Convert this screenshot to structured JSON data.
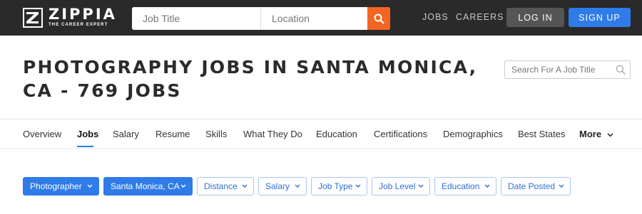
{
  "header": {
    "logo_word": "ZIPPIA",
    "logo_tagline": "THE CAREER EXPERT",
    "job_title_placeholder": "Job Title",
    "location_placeholder": "Location",
    "nav_jobs": "JOBS",
    "nav_careers": "CAREERS",
    "login_label": "LOG IN",
    "signup_label": "SIGN UP",
    "accent": "#f26522",
    "brand_blue": "#2f7be8"
  },
  "page": {
    "title": "PHOTOGRAPHY JOBS IN SANTA MONICA, CA - 769 JOBS",
    "job_search_placeholder": "Search For A Job Title"
  },
  "tabs": {
    "items": [
      "Overview",
      "Jobs",
      "Salary",
      "Resume",
      "Skills",
      "What They Do",
      "Education",
      "Certifications",
      "Demographics",
      "Best States"
    ],
    "active": "Jobs",
    "more_label": "More"
  },
  "filters": {
    "items": [
      "Photographer",
      "Santa Monica, CA",
      "Distance",
      "Salary",
      "Job Type",
      "Job Level",
      "Education",
      "Date Posted"
    ],
    "selected": [
      "Photographer",
      "Santa Monica, CA"
    ]
  }
}
